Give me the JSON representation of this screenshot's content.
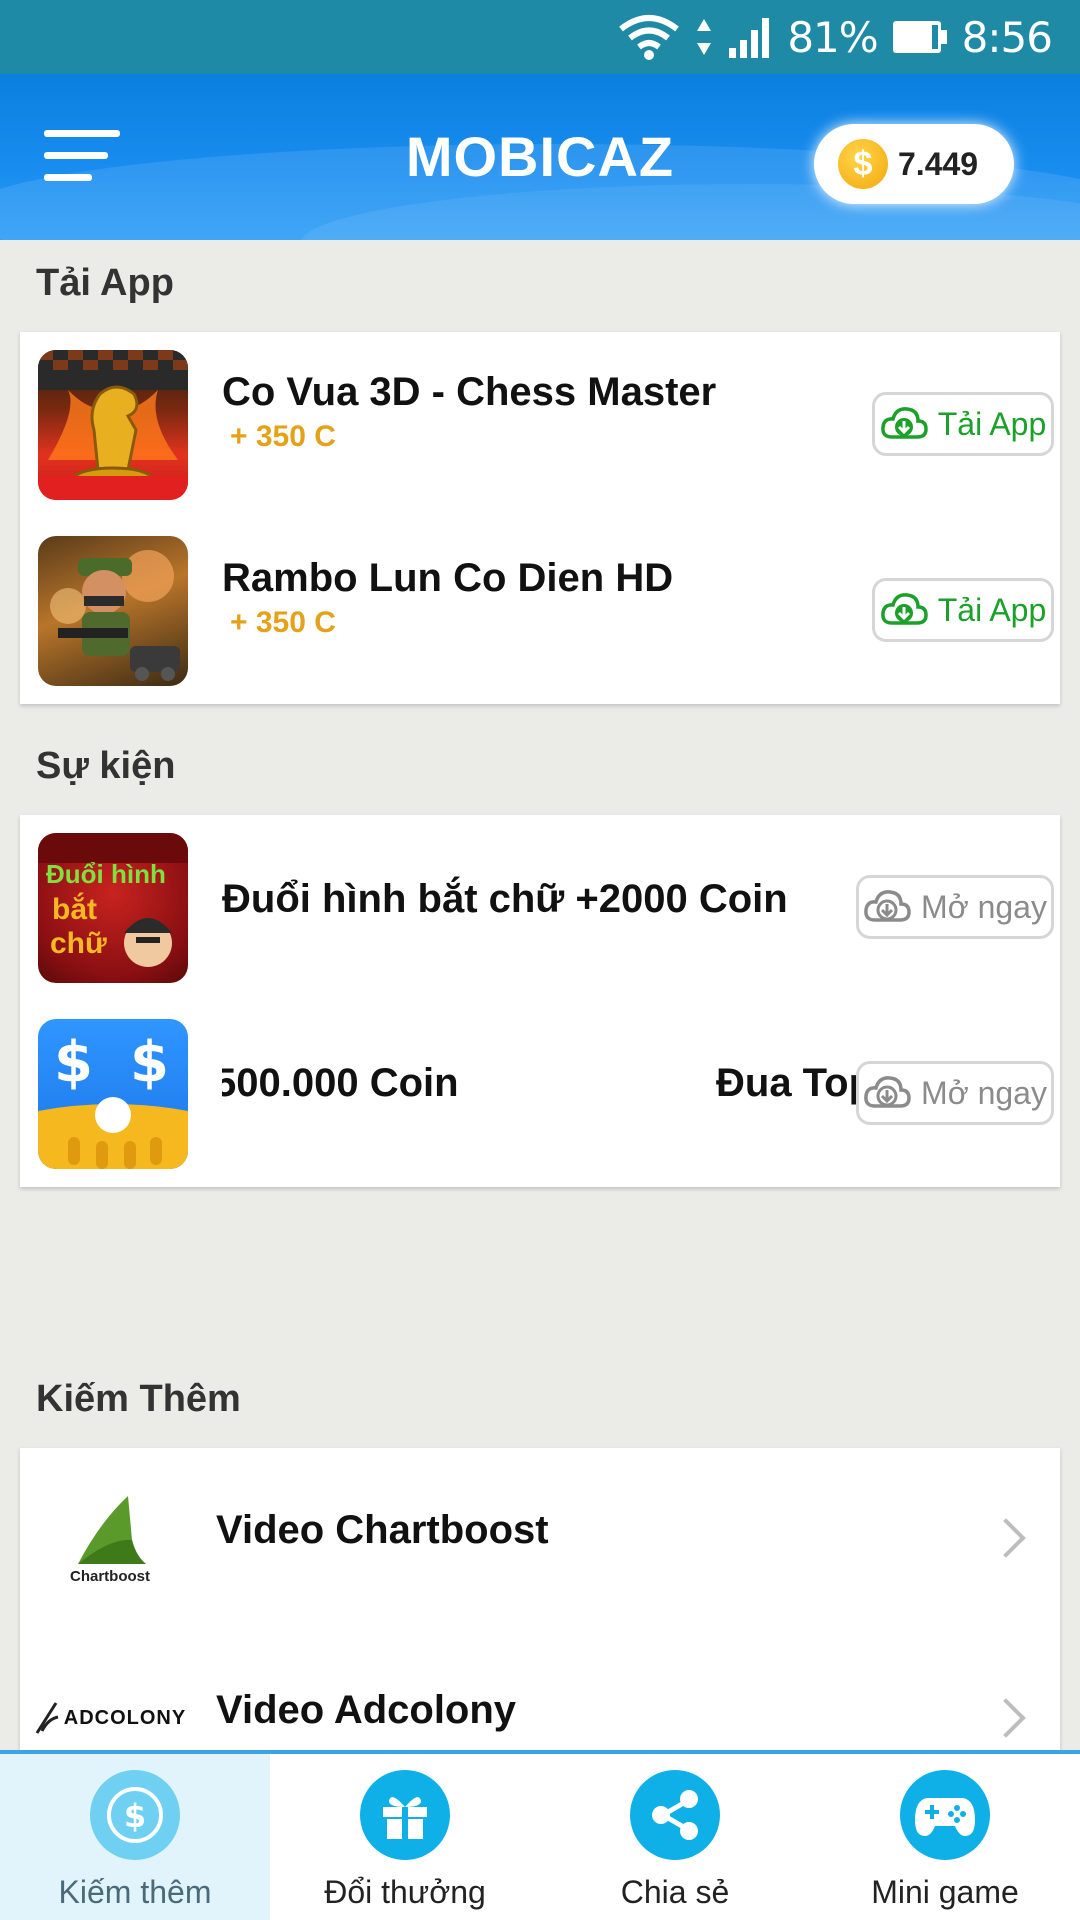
{
  "status_bar": {
    "battery": "81%",
    "time": "8:56"
  },
  "header": {
    "title": "MOBICAZ",
    "coins": "7.449",
    "coin_symbol": "$"
  },
  "download_section": {
    "title": "Tải App",
    "items": [
      {
        "name": "Co Vua 3D - Chess Master",
        "reward": "+ 350 C",
        "button": "Tải App"
      },
      {
        "name": "Rambo Lun Co Dien HD",
        "reward": "+ 350 C",
        "button": "Tải App"
      }
    ]
  },
  "events_section": {
    "title": "Sự kiện",
    "items": [
      {
        "name": "Đuổi hình bắt chữ +2000 Coin",
        "button": "Mở ngay",
        "icon_text": [
          "Đuổi hình",
          "bắt",
          "chữ"
        ]
      },
      {
        "name_part1": "500.000 Coin",
        "name_part2": "Đua Top",
        "button": "Mở ngay"
      }
    ]
  },
  "earn_section": {
    "title": "Kiếm Thêm",
    "items": [
      {
        "name": "Video Chartboost",
        "logo_text": "Chartboost"
      },
      {
        "name": "Video Adcolony",
        "logo_text": "ADCOLONY"
      }
    ]
  },
  "bottom_nav": {
    "tabs": [
      {
        "label": "Kiếm thêm",
        "icon": "dollar-coin-icon",
        "active": true
      },
      {
        "label": "Đổi thưởng",
        "icon": "gift-icon",
        "active": false
      },
      {
        "label": "Chia sẻ",
        "icon": "share-icon",
        "active": false
      },
      {
        "label": "Mini game",
        "icon": "gamepad-icon",
        "active": false
      }
    ]
  },
  "colors": {
    "accent": "#1a8ef0",
    "reward": "#e3a21a",
    "download_green": "#1ba029",
    "nav_icon": "#0fb0e8"
  }
}
